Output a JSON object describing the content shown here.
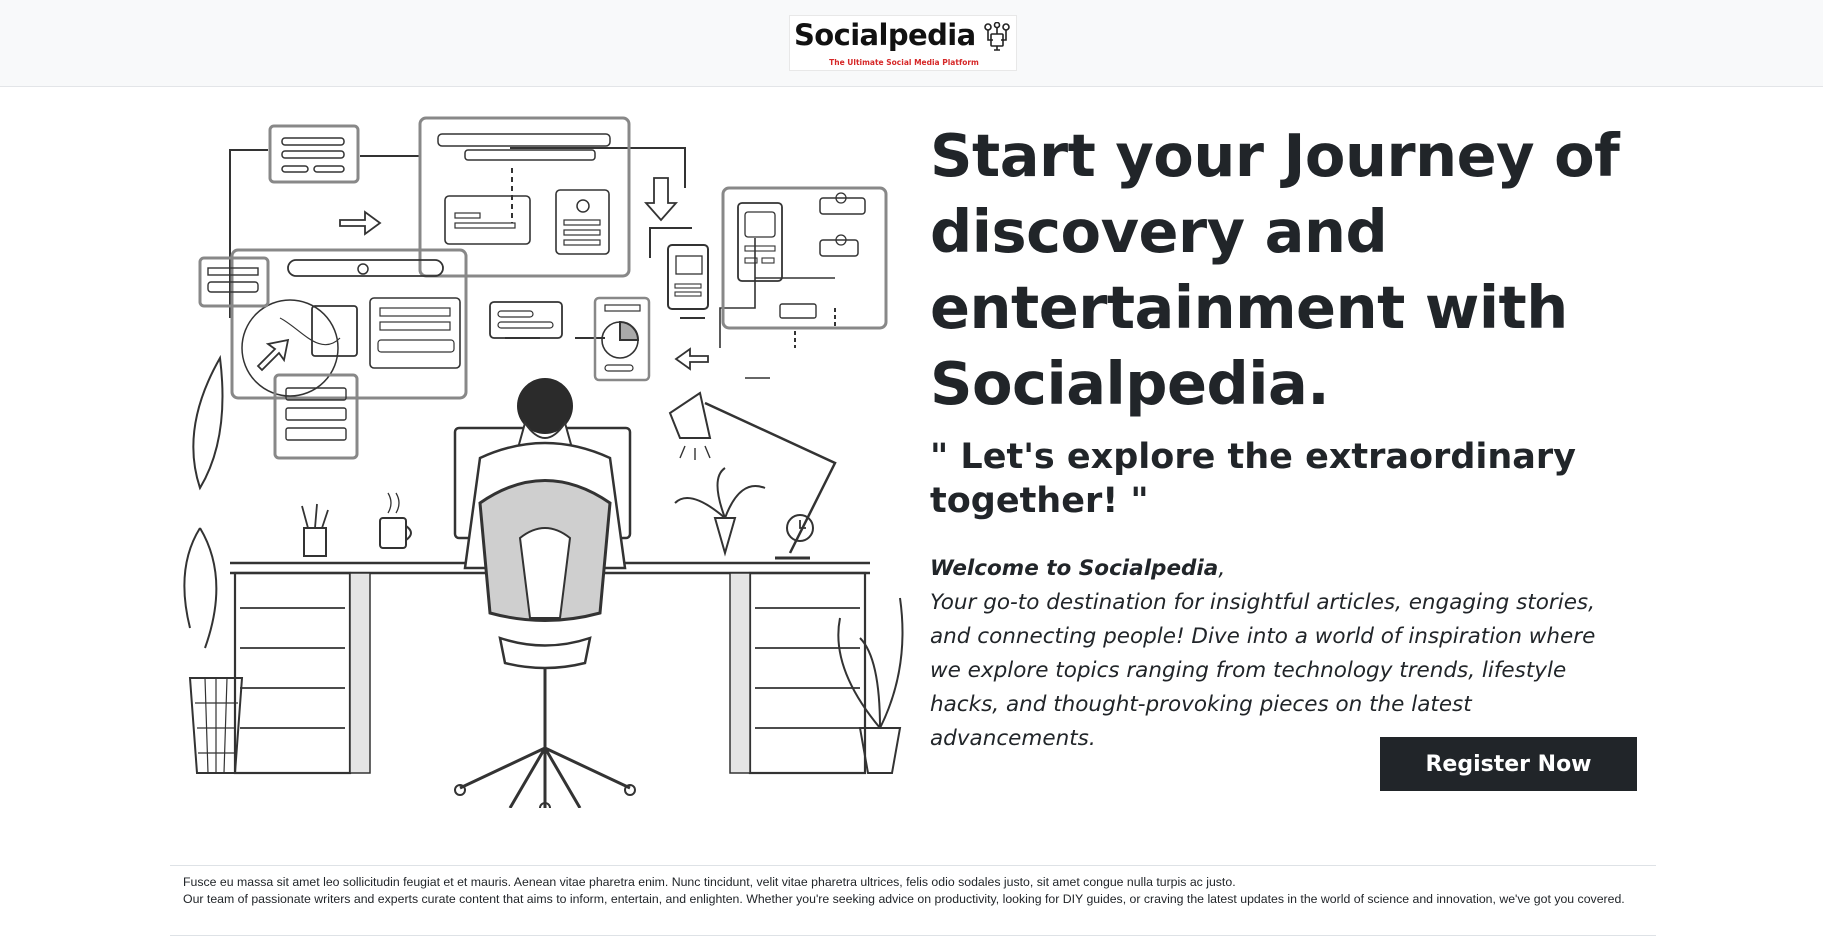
{
  "header": {
    "logo_name": "Socialpedia",
    "logo_tagline": "The Ultimate Social Media Platform"
  },
  "hero": {
    "headline": "Start your Journey of discovery and entertainment with Socialpedia.",
    "quote": "\" Let's explore the extraordinary together! \"",
    "welcome_title": "Welcome to Socialpedia",
    "welcome_comma": ",",
    "welcome_body": "Your go-to destination for insightful articles, engaging stories, and connecting people! Dive into a world of inspiration where we explore topics ranging from technology trends, lifestyle hacks, and thought-provoking pieces on the latest advancements.",
    "register_label": "Register Now"
  },
  "footer": {
    "line1": "Fusce eu massa sit amet leo sollicitudin feugiat et et mauris. Aenean vitae pharetra enim. Nunc tincidunt, velit vitae pharetra ultrices, felis odio sodales justo, sit amet congue nulla turpis ac justo.",
    "line2": "Our team of passionate writers and experts curate content that aims to inform, entertain, and enlighten. Whether you're seeking advice on productivity, looking for DIY guides, or craving the latest updates in the world of science and innovation, we've got you covered."
  },
  "colors": {
    "header_bg": "#f8f9fa",
    "text": "#212529",
    "button_bg": "#212529",
    "button_text": "#ffffff",
    "logo_tagline": "#d62828"
  },
  "icons": [
    "network-logo-icon",
    "arrow-right-icon",
    "arrow-down-icon",
    "arrow-left-icon",
    "arrow-up-right-icon"
  ]
}
